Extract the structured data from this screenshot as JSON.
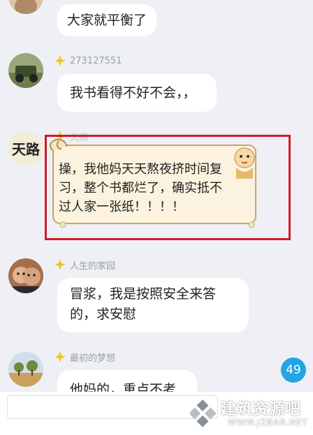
{
  "messages": [
    {
      "name": "",
      "text": "大家就平衡了"
    },
    {
      "name": "273127551",
      "text": "我书看得不好不会，，"
    },
    {
      "name": "天路",
      "avatar_text": "天路",
      "text": "操，我他妈天天熬夜挤时间复习，整个书都烂了，确实抵不过人家一张纸！！！！"
    },
    {
      "name": "人生的家园",
      "text_line1": "冒浆，我是按照安全来答",
      "text_line2": "的，求安慰"
    },
    {
      "name": "最初的梦想",
      "text": "他妈的，重点不考"
    }
  ],
  "unread_count": "49",
  "watermark": {
    "title": "建筑资源吧",
    "url": "WWW.JZBAR.NET"
  },
  "colors": {
    "highlight_border": "#d01a24",
    "unread_badge": "#23a4e4",
    "name_badge": "#f5c518"
  }
}
